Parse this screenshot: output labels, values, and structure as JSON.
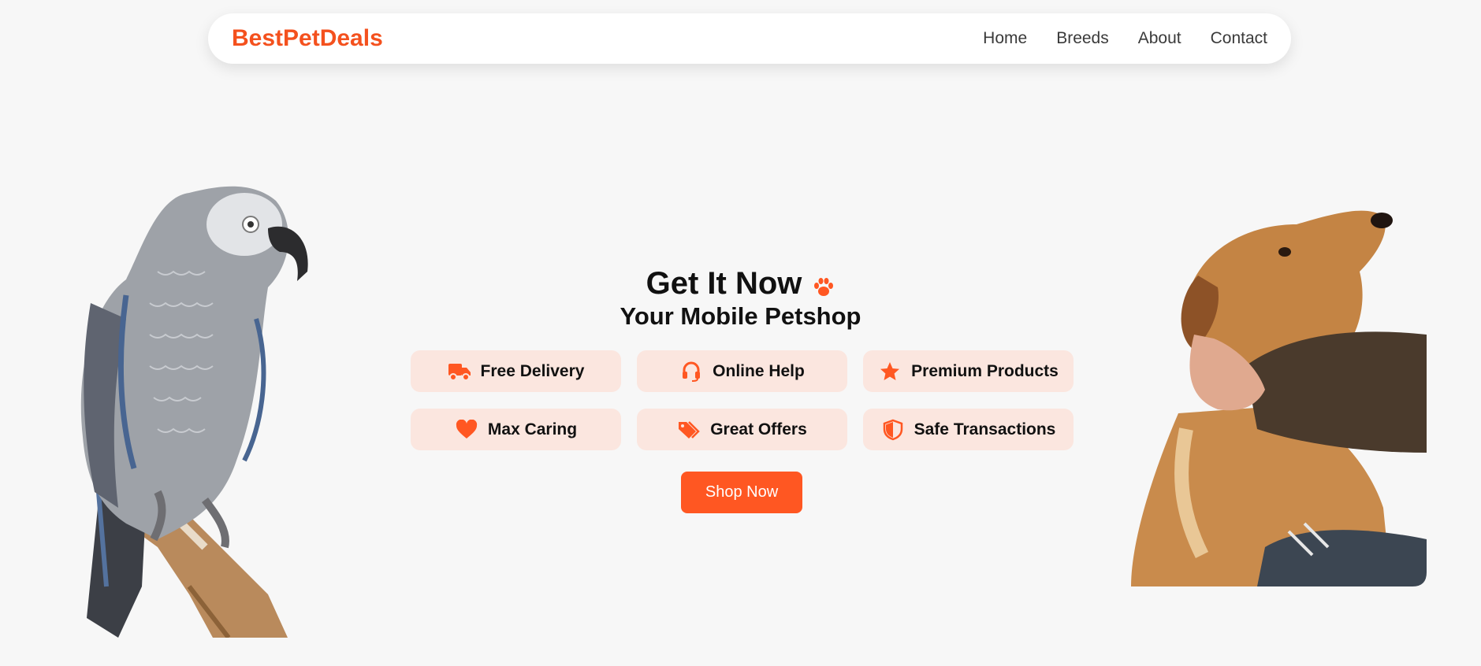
{
  "navbar": {
    "brand": "BestPetDeals",
    "links": [
      "Home",
      "Breeds",
      "About",
      "Contact"
    ]
  },
  "hero": {
    "title": "Get It Now",
    "subtitle": "Your Mobile Petshop",
    "features": [
      {
        "label": "Free Delivery",
        "icon": "truck-icon"
      },
      {
        "label": "Online Help",
        "icon": "headset-icon"
      },
      {
        "label": "Premium Products",
        "icon": "star-icon"
      },
      {
        "label": "Max Caring",
        "icon": "heart-icon"
      },
      {
        "label": "Great Offers",
        "icon": "tags-icon"
      },
      {
        "label": "Safe Transactions",
        "icon": "shield-icon"
      }
    ],
    "cta_label": "Shop Now"
  },
  "colors": {
    "accent": "#ff5722",
    "brand": "#f4511e",
    "feature_bg": "#fbe6df",
    "page_bg": "#f7f7f7"
  }
}
